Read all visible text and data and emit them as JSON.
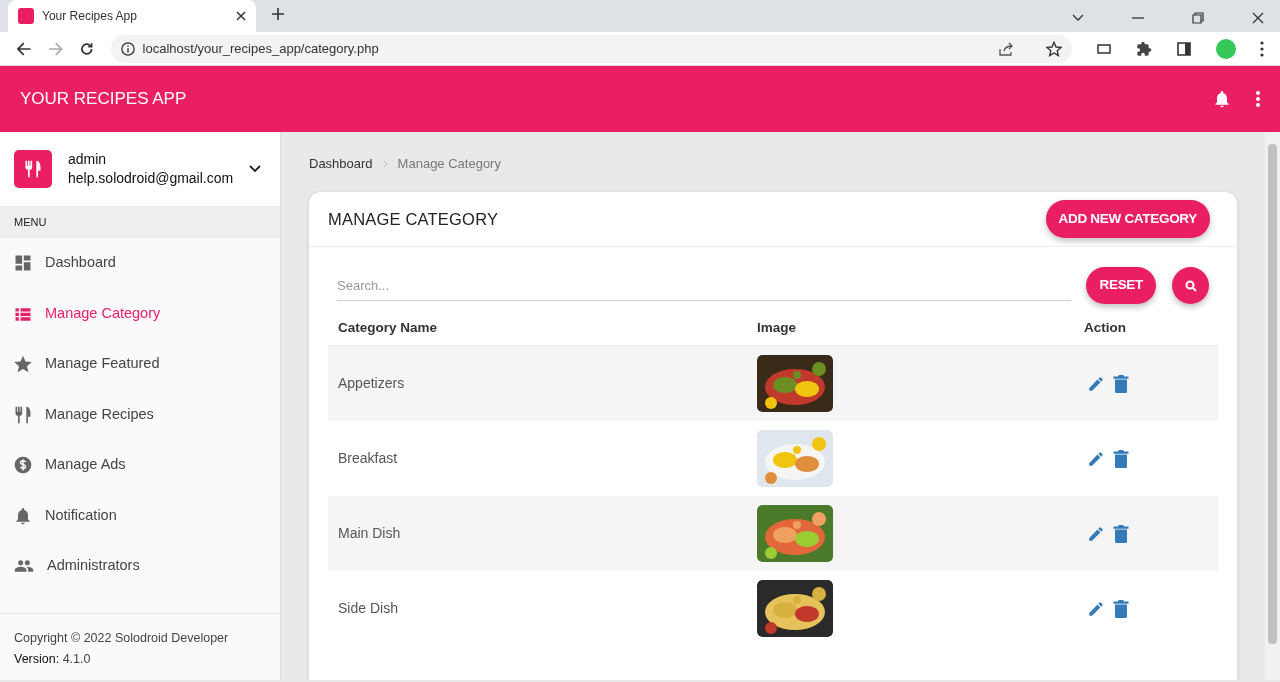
{
  "browser": {
    "tab_title": "Your Recipes App",
    "url": "localhost/your_recipes_app/category.php"
  },
  "app_bar": {
    "title": "YOUR RECIPES APP"
  },
  "user": {
    "name": "admin",
    "email": "help.solodroid@gmail.com"
  },
  "sidebar": {
    "header": "MENU",
    "items": [
      {
        "label": "Dashboard",
        "selected": false
      },
      {
        "label": "Manage Category",
        "selected": true
      },
      {
        "label": "Manage Featured",
        "selected": false
      },
      {
        "label": "Manage Recipes",
        "selected": false
      },
      {
        "label": "Manage Ads",
        "selected": false
      },
      {
        "label": "Notification",
        "selected": false
      },
      {
        "label": "Administrators",
        "selected": false
      }
    ],
    "footer": {
      "copyright": "Copyright © 2022 Solodroid Developer",
      "version_label": "Version:",
      "version": "4.1.0"
    }
  },
  "breadcrumb": [
    {
      "label": "Dashboard"
    },
    {
      "label": "Manage Category"
    }
  ],
  "card": {
    "title": "MANAGE CATEGORY",
    "add_button": "ADD NEW CATEGORY",
    "search": {
      "placeholder": "Search..."
    },
    "reset_button": "RESET",
    "table": {
      "columns": [
        "Category Name",
        "Image",
        "Action"
      ],
      "rows": [
        {
          "name": "Appetizers"
        },
        {
          "name": "Breakfast"
        },
        {
          "name": "Main Dish"
        },
        {
          "name": "Side Dish"
        }
      ]
    }
  }
}
